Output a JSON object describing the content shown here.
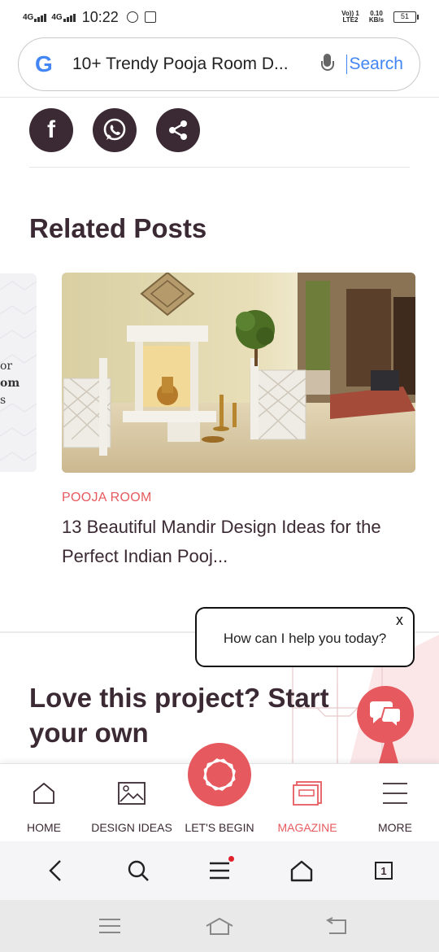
{
  "status_bar": {
    "net1": "4G",
    "net2": "4G",
    "time": "10:22",
    "volte": "Vo)) 1 LTE2",
    "speed": "0.10 KB/s",
    "battery": "51"
  },
  "search": {
    "logo": "G",
    "query": "10+ Trendy Pooja Room D...",
    "button": "Search"
  },
  "social": {
    "icons": [
      "facebook-icon",
      "whatsapp-icon",
      "share-icon"
    ],
    "facebook_glyph": "f"
  },
  "related": {
    "heading": "Related Posts",
    "prev_card_fragments": [
      "or",
      "om",
      "s"
    ],
    "post": {
      "category": "POOJA ROOM",
      "title": "13 Beautiful Mandir Design Ideas for the Perfect Indian Pooj..."
    }
  },
  "chat": {
    "message": "How can I help you today?",
    "close": "x"
  },
  "cta": {
    "heading": "Love this project? Start your own"
  },
  "bottom_nav": {
    "items": [
      {
        "label": "HOME",
        "icon": "home-icon"
      },
      {
        "label": "DESIGN IDEAS",
        "icon": "image-icon"
      },
      {
        "label": "LET'S BEGIN",
        "icon": "logo-icon"
      },
      {
        "label": "MAGAZINE",
        "icon": "magazine-icon",
        "active": true
      },
      {
        "label": "MORE",
        "icon": "menu-icon"
      }
    ]
  },
  "browser_bar": {
    "tab_count": "1"
  },
  "colors": {
    "accent": "#e65a5f",
    "text": "#3b2a33",
    "google_blue": "#4285f4"
  }
}
